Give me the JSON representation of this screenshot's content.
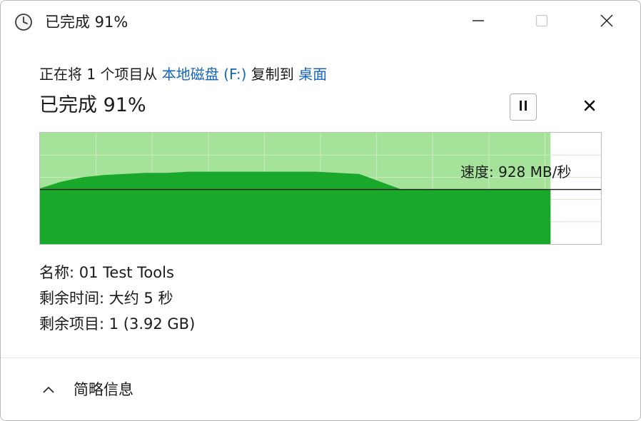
{
  "window": {
    "title": "已完成 91%",
    "controls": {
      "minimize_icon": "minimize-icon",
      "maximize_icon": "maximize-icon",
      "close_icon": "close-icon"
    },
    "title_icon": "clock-icon"
  },
  "operation": {
    "prefix": "正在将 1 个项目从 ",
    "source": "本地磁盘 (F:)",
    "middle": " 复制到 ",
    "destination": "桌面",
    "link_color": "#1565c0"
  },
  "progress": {
    "label": "已完成 91%",
    "percent": 91,
    "pause_icon": "pause-icon",
    "cancel_icon": "cancel-icon"
  },
  "speed": {
    "label": "速度: 928 MB/秒"
  },
  "chart_data": {
    "type": "area",
    "progress_fraction": 0.91,
    "current_speed_fraction": 0.49,
    "speed_profile": [
      0.5,
      0.56,
      0.6,
      0.62,
      0.63,
      0.64,
      0.64,
      0.65,
      0.65,
      0.65,
      0.65,
      0.65,
      0.65,
      0.65,
      0.64,
      0.63,
      0.56,
      0.49,
      0.49,
      0.49,
      0.49,
      0.49,
      0.49,
      0.49,
      0.49
    ],
    "colors": {
      "fill": "#1aa82a",
      "background": "#a5e39a",
      "grid": "#c9ecc2",
      "remaining": "#ffffff",
      "line": "#1a1a1a"
    }
  },
  "details": {
    "name": "名称: 01 Test Tools",
    "time_remaining": "剩余时间: 大约 5 秒",
    "items_remaining": "剩余项目: 1 (3.92 GB)"
  },
  "footer": {
    "toggle_label": "简略信息",
    "toggle_icon": "chevron-up-icon"
  }
}
